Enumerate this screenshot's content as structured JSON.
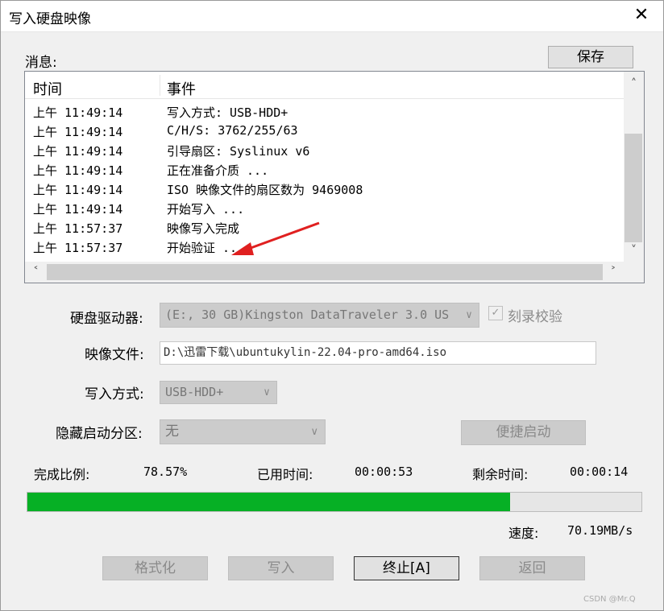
{
  "window": {
    "title": "写入硬盘映像",
    "close_glyph": "✕"
  },
  "messages": {
    "label": "消息:",
    "save_label": "保存",
    "columns": {
      "time": "时间",
      "event": "事件"
    },
    "rows": [
      {
        "time": "上午 11:49:14",
        "event": "写入方式: USB-HDD+"
      },
      {
        "time": "上午 11:49:14",
        "event": "C/H/S: 3762/255/63"
      },
      {
        "time": "上午 11:49:14",
        "event": "引导扇区: Syslinux v6"
      },
      {
        "time": "上午 11:49:14",
        "event": "正在准备介质 ..."
      },
      {
        "time": "上午 11:49:14",
        "event": "ISO 映像文件的扇区数为 9469008"
      },
      {
        "time": "上午 11:49:14",
        "event": "开始写入 ..."
      },
      {
        "time": "上午 11:57:37",
        "event": "映像写入完成"
      },
      {
        "time": "上午 11:57:37",
        "event": "开始验证 ..."
      }
    ]
  },
  "form": {
    "drive_label": "硬盘驱动器:",
    "drive_value": "(E:, 30 GB)Kingston DataTraveler 3.0 US",
    "verify_label": "刻录校验",
    "verify_checked": true,
    "image_label": "映像文件:",
    "image_value": "D:\\迅雷下载\\ubuntukylin-22.04-pro-amd64.iso",
    "mode_label": "写入方式:",
    "mode_value": "USB-HDD+",
    "hidden_label": "隐藏启动分区:",
    "hidden_value": "无",
    "quick_boot_label": "便捷启动"
  },
  "status": {
    "percent_label": "完成比例:",
    "percent_value": "78.57%",
    "progress_fraction": 0.7857,
    "elapsed_label": "已用时间:",
    "elapsed_value": "00:00:53",
    "remaining_label": "剩余时间:",
    "remaining_value": "00:00:14",
    "speed_label": "速度:",
    "speed_value": "70.19MB/s"
  },
  "buttons": {
    "format": "格式化",
    "write": "写入",
    "stop": "终止[A]",
    "back": "返回"
  },
  "watermark": "CSDN @Mr.Q",
  "colors": {
    "progress_fill": "#06b025",
    "annotation_arrow": "#e02020"
  }
}
